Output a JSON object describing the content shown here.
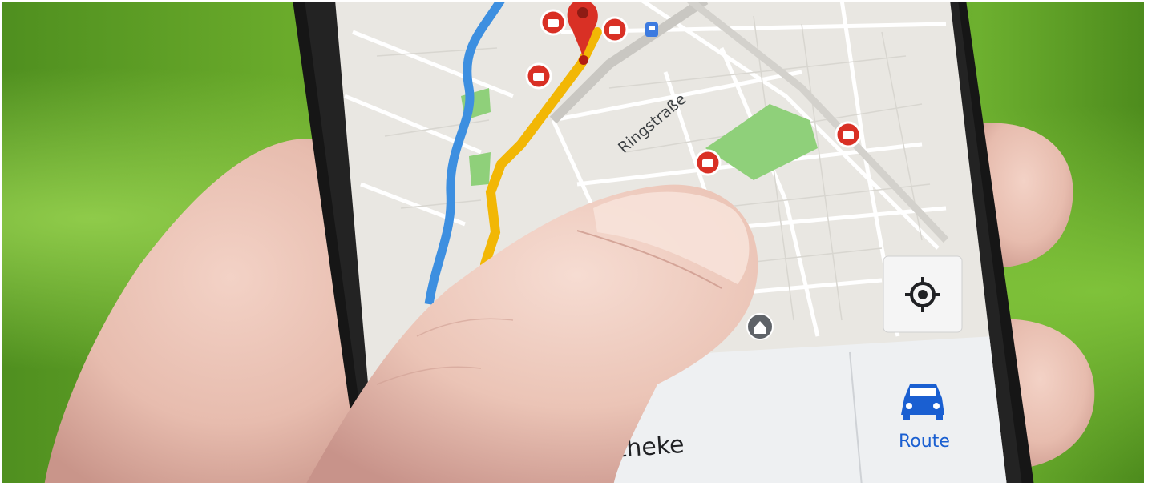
{
  "map": {
    "street_label": "Ringstraße",
    "pin_icon": "location-pin-icon",
    "poi_icon": "shopping-bag-icon",
    "transit_icon": "bus-stop-icon",
    "home_icon": "home-icon",
    "colors": {
      "route": "#f2b705",
      "river": "#3d8fe0",
      "park": "#8fd07a",
      "land": "#e9e7e2",
      "pin": "#d93025"
    }
  },
  "controls": {
    "locate_icon": "my-location-icon"
  },
  "bottom_sheet": {
    "place_title": "otheke",
    "route_label": "Route",
    "route_icon": "car-icon",
    "accent_color": "#1a5fd1"
  }
}
